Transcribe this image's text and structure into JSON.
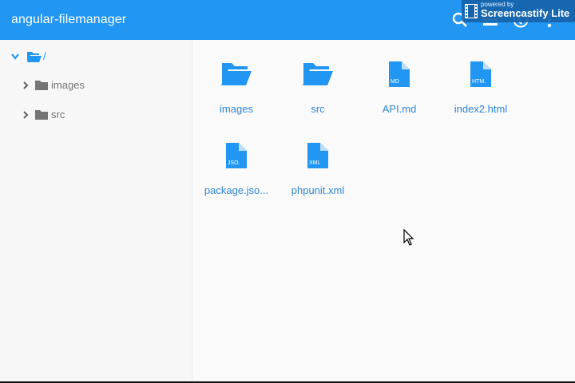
{
  "app": {
    "title": "angular-filemanager"
  },
  "watermark": {
    "powered": "powered by",
    "brand": "Screencastify Lite"
  },
  "toolbar": {
    "icons": [
      "search-icon",
      "list-view-icon",
      "language-icon",
      "more-vert-icon"
    ]
  },
  "colors": {
    "primary": "#2196f3",
    "item_label": "#2f86d9",
    "icon_blue": "#2196f3",
    "tree_text": "#757575"
  },
  "sidebar": {
    "root": {
      "label": "/",
      "expanded": true
    },
    "children": [
      {
        "label": "images",
        "expanded": false
      },
      {
        "label": "src",
        "expanded": false
      }
    ]
  },
  "files": [
    {
      "name": "images",
      "type": "folder",
      "badge": ""
    },
    {
      "name": "src",
      "type": "folder",
      "badge": ""
    },
    {
      "name": "API.md",
      "type": "file",
      "badge": "MD"
    },
    {
      "name": "index2.html",
      "type": "file",
      "badge": "HTM."
    },
    {
      "name": "package.jso...",
      "type": "file",
      "badge": "JSO."
    },
    {
      "name": "phpunit.xml",
      "type": "file",
      "badge": "XML"
    }
  ]
}
